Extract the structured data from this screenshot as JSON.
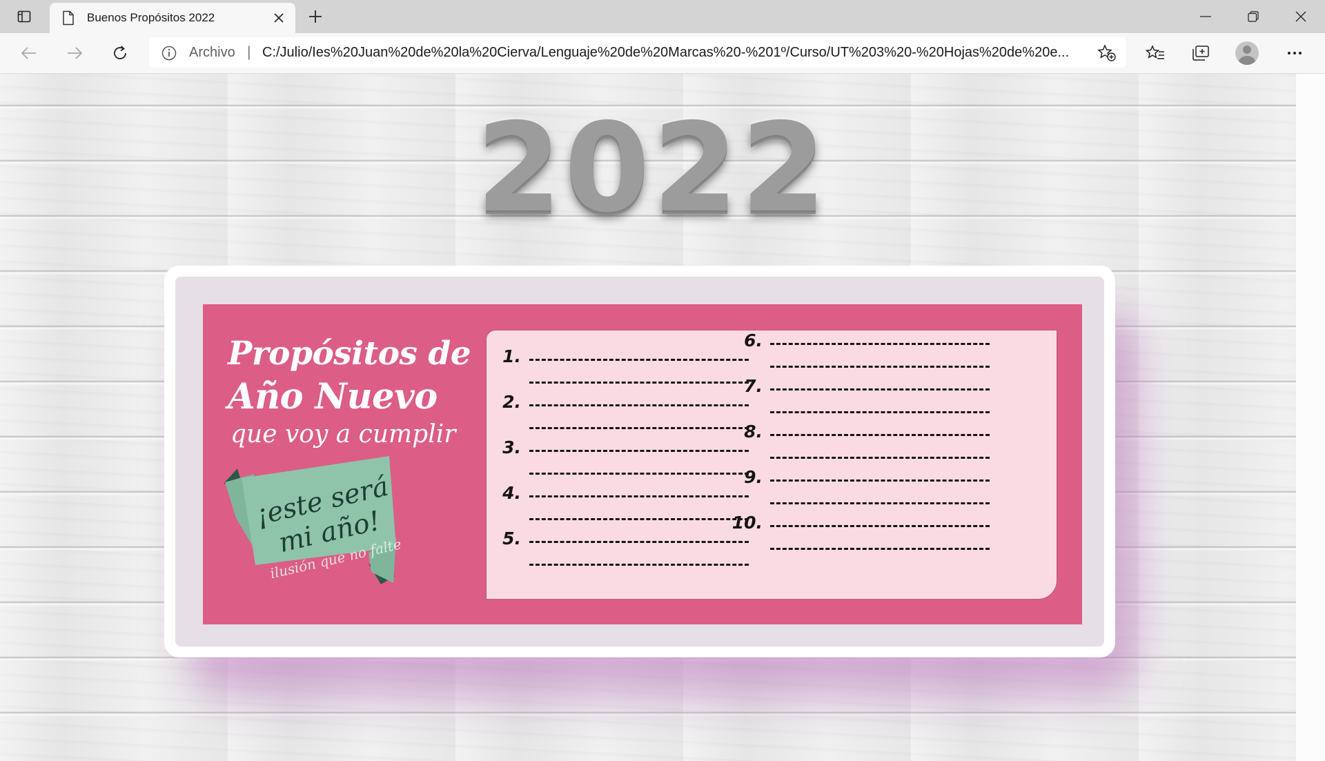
{
  "browser": {
    "tab_title": "Buenos Propósitos 2022",
    "address_prefix": "Archivo",
    "address_separator": "|",
    "url": "C:/Julio/Ies%20Juan%20de%20la%20Cierva/Lenguaje%20de%20Marcas%20-%201º/Curso/UT%203%20-%20Hojas%20de%20e..."
  },
  "icons": {
    "tab_actions": "tab-actions-icon",
    "page": "page-icon",
    "close_tab": "close-icon",
    "new_tab": "plus-icon",
    "minimize": "minimize-icon",
    "restore": "restore-icon",
    "close_window": "close-icon",
    "back": "back-arrow-icon",
    "forward": "forward-arrow-icon",
    "refresh": "refresh-icon",
    "info": "info-icon",
    "add_favorite": "star-add-icon",
    "favorites": "favorites-icon",
    "collections": "collections-icon",
    "profile": "profile-avatar",
    "more": "more-icon"
  },
  "page": {
    "year": "2022",
    "heading_line1": "Propósitos de",
    "heading_line2": "Año Nuevo",
    "heading_line3": "que voy a cumplir",
    "ribbon_line1": "¡este será",
    "ribbon_line2": "mi año!",
    "ribbon_line3": "ilusión que no falte",
    "numbers_left": [
      "1.",
      "2.",
      "3.",
      "4.",
      "5."
    ],
    "numbers_right": [
      "6.",
      "7.",
      "8.",
      "9.",
      "10."
    ]
  },
  "colors": {
    "poster_pink": "#dc5d86",
    "panel_pink": "#fadbe3",
    "ribbon_green": "#8fc4ab",
    "ribbon_dark_green": "#2b5a47"
  }
}
